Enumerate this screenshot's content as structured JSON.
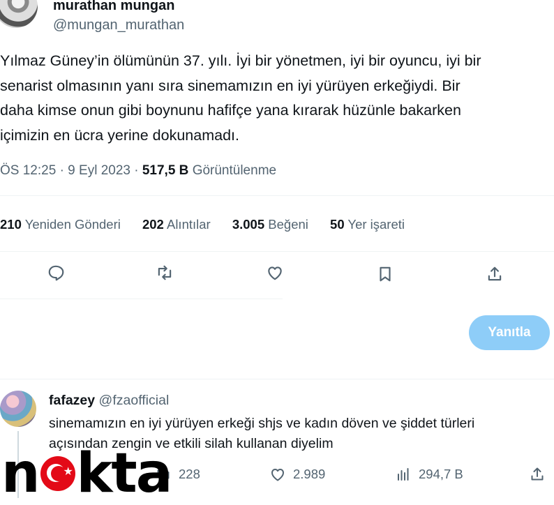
{
  "tweet": {
    "author_name": "murathan mungan",
    "author_handle": "@mungan_murathan",
    "text_lines": [
      "Yılmaz Güney’in ölümünün 37.  yılı. İyi bir yönetmen, iyi bir oyuncu, iyi bir",
      "senarist olmasının yanı sıra sinemamızın en iyi yürüyen erkeğiydi. Bir",
      "daha kimse onun gibi boynunu hafifçe yana kırarak hüzünle bakarken",
      "içimizin en ücra yerine dokunamadı."
    ],
    "time": "ÖS 12:25",
    "date": "9 Eyl 2023",
    "views_count": "517,5 B",
    "views_label": "Görüntülenme",
    "stats": {
      "retweets": "210",
      "retweets_label": "Yeniden Gönderi",
      "quotes": "202",
      "quotes_label": "Alıntılar",
      "likes": "3.005",
      "likes_label": "Beğeni",
      "bookmarks": "50",
      "bookmarks_label": "Yer işareti"
    },
    "action_icons": [
      "reply-icon",
      "retweet-icon",
      "like-icon",
      "bookmark-icon",
      "share-icon"
    ]
  },
  "reply_button_label": "Yanıtla",
  "reply": {
    "author_name": "fafazey",
    "author_handle": "@fzaofficial",
    "text_lines": [
      "sinemamızın en iyi yürüyen erkeği shjs ve kadın döven ve şiddet türleri",
      "açısından zengin ve etkili silah kullanan diyelim"
    ],
    "retweets": "228",
    "likes": "2.989",
    "views": "294,7 B"
  },
  "watermark": {
    "before": "n",
    "after": "kta",
    "flag_colors": {
      "red": "#e30a17",
      "white": "#ffffff"
    }
  },
  "colors": {
    "accent_disabled": "#8ecdf8",
    "secondary_text": "#536471",
    "primary_text": "#0f1419"
  }
}
